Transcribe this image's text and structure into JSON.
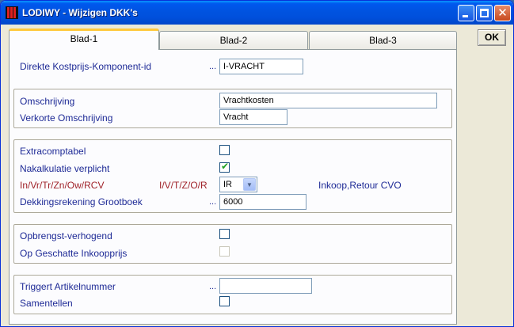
{
  "window": {
    "title": "LODIWY - Wijzigen DKK's",
    "min_glyph": "",
    "close_glyph": "✕"
  },
  "ok_label": "OK",
  "tabs": [
    {
      "label": "Blad-1",
      "active": true
    },
    {
      "label": "Blad-2",
      "active": false
    },
    {
      "label": "Blad-3",
      "active": false
    }
  ],
  "dots": "...",
  "id_section": {
    "label": "Direkte Kostprijs-Komponent-id",
    "value": "I-VRACHT"
  },
  "description": {
    "omschrijving_label": "Omschrijving",
    "omschrijving_value": "Vrachtkosten",
    "verkort_label": "Verkorte Omschrijving",
    "verkort_value": "Vracht"
  },
  "accounting": {
    "extracomptabel_label": "Extracomptabel",
    "extracomptabel_checked": false,
    "nakalkulatie_label": "Nakalkulatie verplicht",
    "nakalkulatie_checked": true,
    "codes_label": "In/Vr/Tr/Zn/Ow/RCV",
    "type_label": "I/V/T/Z/O/R",
    "type_value": "IR",
    "type_info": "Inkoop,Retour CVO",
    "dekking_label": "Dekkingsrekening Grootboek",
    "dekking_value": "6000"
  },
  "revenue": {
    "opbrengst_label": "Opbrengst-verhogend",
    "opbrengst_checked": false,
    "geschatte_label": "Op Geschatte Inkoopprijs",
    "geschatte_checked": false
  },
  "trigger": {
    "artikel_label": "Triggert Artikelnummer",
    "artikel_value": "",
    "samentellen_label": "Samentellen",
    "samentellen_checked": false
  },
  "colors": {
    "label_blue": "#1e2a96",
    "label_red": "#a0232a",
    "tab_highlight": "#ffc83c",
    "check_green": "#21a121"
  }
}
